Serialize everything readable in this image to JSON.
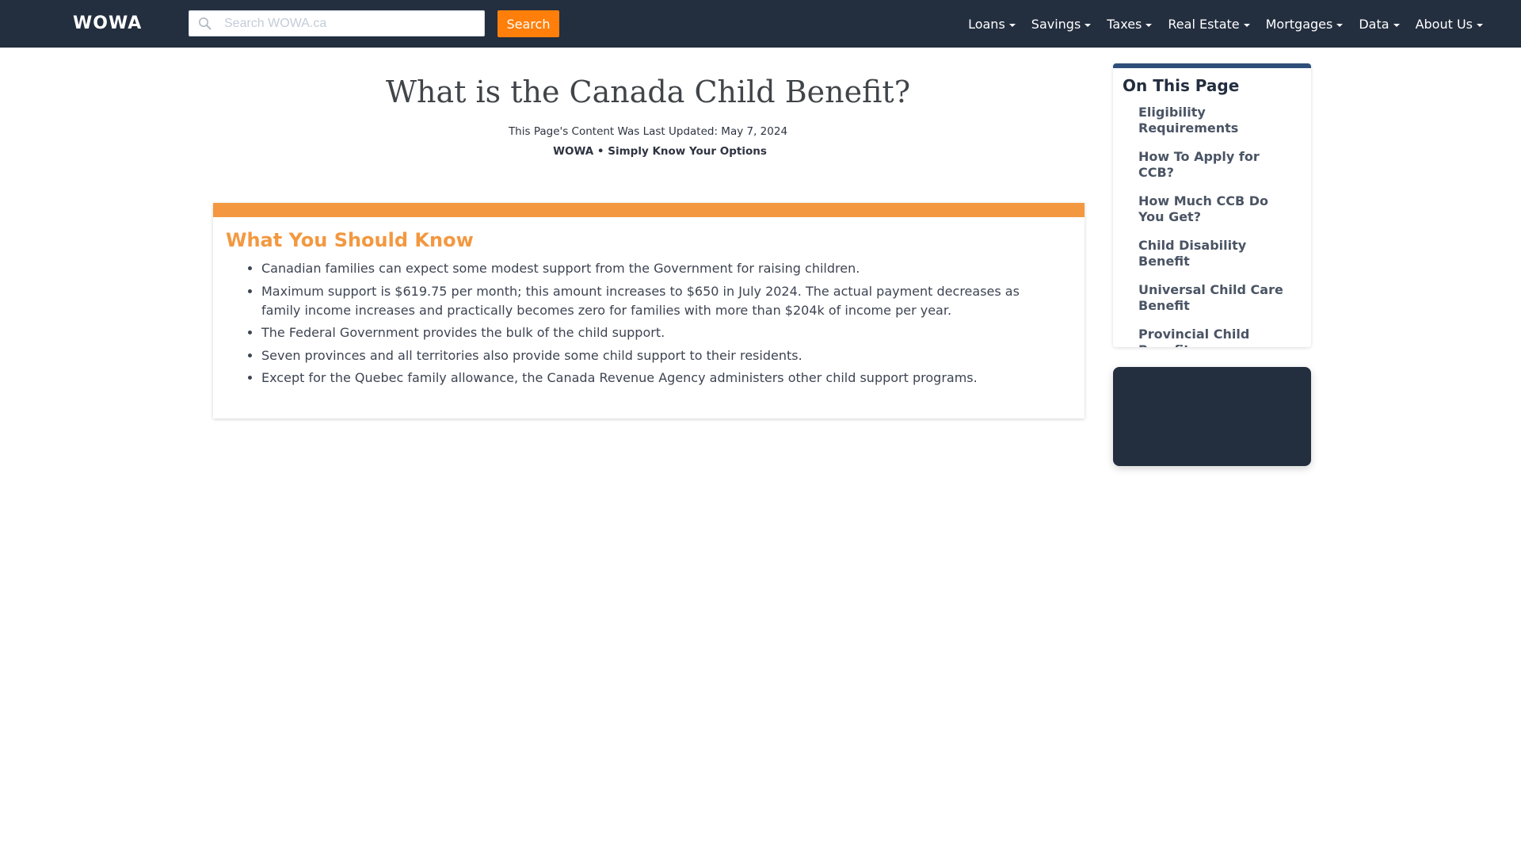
{
  "navbar": {
    "logo": "WOWA",
    "search": {
      "placeholder": "Search WOWA.ca",
      "value": "",
      "button_label": "Search",
      "icon": "search-icon"
    },
    "menu": [
      {
        "label": "Loans"
      },
      {
        "label": "Savings"
      },
      {
        "label": "Taxes"
      },
      {
        "label": "Real Estate"
      },
      {
        "label": "Mortgages"
      },
      {
        "label": "Data"
      },
      {
        "label": "About Us"
      }
    ]
  },
  "header": {
    "title": "What is the Canada Child Benefit?",
    "updated": "This Page's Content Was Last Updated: May 7, 2024",
    "tagline": "WOWA • Simply Know Your Options"
  },
  "summary_card": {
    "heading": "What You Should Know",
    "items": [
      "Canadian families can expect some modest support from the Government for raising children.",
      "Maximum support is $619.75 per month; this amount increases to $650 in July 2024. The actual payment decreases as family income increases and practically becomes zero for families with more than $204k of income per year.",
      "The Federal Government provides the bulk of the child support.",
      "Seven provinces and all territories also provide some child support to their residents.",
      "Except for the Quebec family allowance, the Canada Revenue Agency administers other child support programs."
    ]
  },
  "sidebar": {
    "title": "On This Page",
    "items": [
      {
        "label": "Eligibility Requirements"
      },
      {
        "label": "How To Apply for CCB?"
      },
      {
        "label": "How Much CCB Do You Get?"
      },
      {
        "label": "Child Disability Benefit"
      },
      {
        "label": "Universal Child Care Benefit"
      },
      {
        "label": "Provincial Child Benefits"
      }
    ]
  },
  "colors": {
    "navbar_bg": "#232e3f",
    "accent_orange": "#ff7f0a",
    "card_orange": "#f39840",
    "toc_blue": "#2f4f7a"
  }
}
